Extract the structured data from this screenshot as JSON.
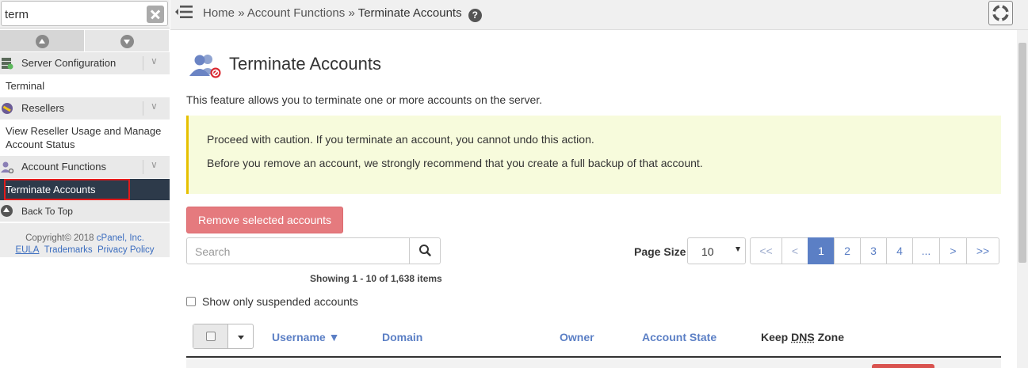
{
  "sidebar": {
    "search_value": "term",
    "categories": [
      {
        "label": "Server Configuration",
        "items": [
          "Terminal"
        ]
      },
      {
        "label": "Resellers",
        "items": [
          "View Reseller Usage and Manage Account Status"
        ]
      },
      {
        "label": "Account Functions",
        "items": [
          "Terminate Accounts"
        ]
      }
    ],
    "back_to_top": "Back To Top",
    "footer": {
      "copyright": "Copyright© 2018",
      "company": "cPanel, Inc.",
      "links": [
        "EULA",
        "Trademarks",
        "Privacy Policy"
      ]
    }
  },
  "breadcrumb": {
    "home": "Home",
    "section": "Account Functions",
    "current": "Terminate Accounts",
    "separator": "»",
    "help": "?"
  },
  "page": {
    "title": "Terminate Accounts",
    "description": "This feature allows you to terminate one or more accounts on the server.",
    "warning_lines": [
      "Proceed with caution. If you terminate an account, you cannot undo this action.",
      "Before you remove an account, we strongly recommend that you create a full backup of that account."
    ],
    "remove_button": "Remove selected accounts",
    "search_placeholder": "Search",
    "showing": "Showing 1 - 10 of 1,638 items",
    "page_size_label": "Page Size",
    "page_size_value": "10",
    "pagination": [
      "<<",
      "<",
      "1",
      "2",
      "3",
      "4",
      "...",
      ">",
      ">>"
    ],
    "active_page": "1",
    "show_suspended": "Show only suspended accounts",
    "columns": {
      "username": "Username ▼",
      "domain": "Domain",
      "owner": "Owner",
      "account_state": "Account State",
      "keep_dns_prefix": "Keep ",
      "keep_dns_abbr": "DNS",
      "keep_dns_suffix": " Zone"
    }
  },
  "colors": {
    "accent": "#5b7fc5",
    "danger": "#e57a7e",
    "warning_bg": "#f7fbdc",
    "warning_border": "#e6c000",
    "sidebar_active": "#2d3a4a",
    "highlight_red": "#e21b1b"
  },
  "icons": [
    "clear-search-icon",
    "arrow-up-icon",
    "arrow-down-icon",
    "server-config-icon",
    "resellers-icon",
    "account-functions-icon",
    "back-to-top-icon",
    "menu-collapse-icon",
    "help-icon",
    "lifebuoy-icon",
    "terminate-accounts-icon",
    "search-icon"
  ]
}
